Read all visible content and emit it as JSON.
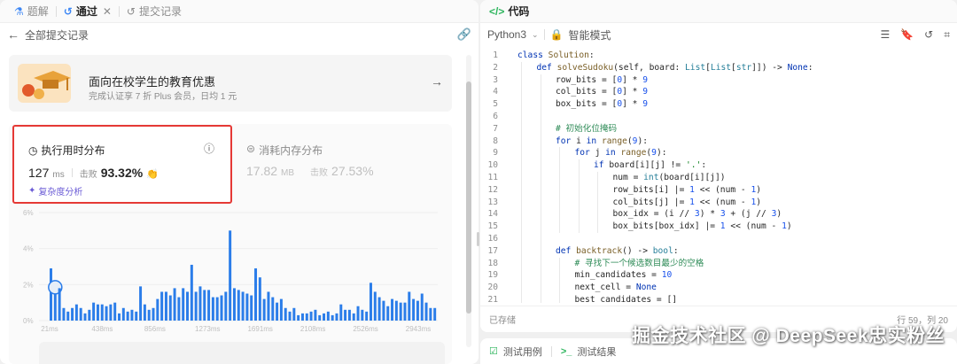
{
  "left_panel": {
    "tabs": [
      {
        "label": "题解",
        "icon": "flask-icon"
      },
      {
        "label": "通过",
        "icon": "history-icon",
        "active": true
      },
      {
        "label": "提交记录",
        "icon": "history-icon"
      }
    ],
    "back_label": "全部提交记录",
    "promo": {
      "title": "面向在校学生的教育优惠",
      "subtitle": "完成认证享 7 折 Plus 会员，日均 1 元"
    },
    "runtime": {
      "title": "执行用时分布",
      "value": "127",
      "unit": "ms",
      "beat_label": "击败",
      "beat_pct": "93.32%",
      "analysis_link": "复杂度分析"
    },
    "memory": {
      "title": "消耗内存分布",
      "value": "17.82",
      "unit": "MB",
      "beat_label": "击败",
      "beat_pct": "27.53%"
    }
  },
  "chart_data": {
    "type": "bar",
    "title": "",
    "xlabel": "",
    "ylabel": "",
    "ylim": [
      0,
      6
    ],
    "y_ticks": [
      "0%",
      "2%",
      "4%",
      "6%"
    ],
    "x_ticks": [
      "21ms",
      "438ms",
      "856ms",
      "1273ms",
      "1691ms",
      "2108ms",
      "2526ms",
      "2943ms"
    ],
    "values": [
      2.9,
      1.8,
      1.8,
      0.7,
      0.5,
      0.7,
      0.9,
      0.7,
      0.4,
      0.6,
      1.0,
      0.9,
      0.9,
      0.8,
      0.9,
      1.0,
      0.4,
      0.7,
      0.5,
      0.6,
      0.5,
      1.9,
      0.9,
      0.6,
      0.7,
      1.2,
      1.6,
      1.6,
      1.4,
      1.8,
      1.3,
      1.8,
      1.6,
      3.1,
      1.6,
      1.9,
      1.7,
      1.7,
      1.3,
      1.3,
      1.4,
      1.6,
      5.0,
      1.8,
      1.7,
      1.6,
      1.5,
      1.4,
      2.9,
      2.4,
      1.2,
      1.6,
      1.3,
      1.0,
      1.2,
      0.7,
      0.5,
      0.7,
      0.3,
      0.4,
      0.4,
      0.5,
      0.6,
      0.3,
      0.4,
      0.5,
      0.3,
      0.4,
      0.9,
      0.6,
      0.6,
      0.4,
      0.8,
      0.6,
      0.5,
      2.1,
      1.6,
      1.3,
      1.1,
      0.8,
      1.2,
      1.1,
      1.0,
      1.0,
      1.6,
      1.2,
      1.1,
      1.5,
      1.0,
      0.7,
      0.7
    ],
    "highlight_index": 1,
    "color": "#2b7de9"
  },
  "right_panel": {
    "title": "代码",
    "language": "Python3",
    "mode": "智能模式",
    "status_left": "已存储",
    "status_right": "行 59，列 20",
    "bottom_tabs": [
      "测试用例",
      "测试结果"
    ],
    "code_lines": [
      {
        "n": "1",
        "i": 0,
        "t": "class Solution:"
      },
      {
        "n": "2",
        "i": 1,
        "t": "def solveSudoku(self, board: List[List[str]]) -> None:"
      },
      {
        "n": "3",
        "i": 2,
        "t": "row_bits = [0] * 9"
      },
      {
        "n": "4",
        "i": 2,
        "t": "col_bits = [0] * 9"
      },
      {
        "n": "5",
        "i": 2,
        "t": "box_bits = [0] * 9"
      },
      {
        "n": "6",
        "i": 0,
        "t": ""
      },
      {
        "n": "7",
        "i": 2,
        "t": "# 初始化位掩码"
      },
      {
        "n": "8",
        "i": 2,
        "t": "for i in range(9):"
      },
      {
        "n": "9",
        "i": 3,
        "t": "for j in range(9):"
      },
      {
        "n": "10",
        "i": 4,
        "t": "if board[i][j] != '.':"
      },
      {
        "n": "11",
        "i": 5,
        "t": "num = int(board[i][j])"
      },
      {
        "n": "12",
        "i": 5,
        "t": "row_bits[i] |= 1 << (num - 1)"
      },
      {
        "n": "13",
        "i": 5,
        "t": "col_bits[j] |= 1 << (num - 1)"
      },
      {
        "n": "14",
        "i": 5,
        "t": "box_idx = (i // 3) * 3 + (j // 3)"
      },
      {
        "n": "15",
        "i": 5,
        "t": "box_bits[box_idx] |= 1 << (num - 1)"
      },
      {
        "n": "16",
        "i": 0,
        "t": ""
      },
      {
        "n": "17",
        "i": 2,
        "t": "def backtrack() -> bool:"
      },
      {
        "n": "18",
        "i": 3,
        "t": "# 寻找下一个候选数目最少的空格"
      },
      {
        "n": "19",
        "i": 3,
        "t": "min_candidates = 10"
      },
      {
        "n": "20",
        "i": 3,
        "t": "next_cell = None"
      },
      {
        "n": "21",
        "i": 3,
        "t": "best_candidates = []"
      }
    ]
  },
  "watermark": "掘金技术社区 @ DeepSeek忠实粉丝"
}
